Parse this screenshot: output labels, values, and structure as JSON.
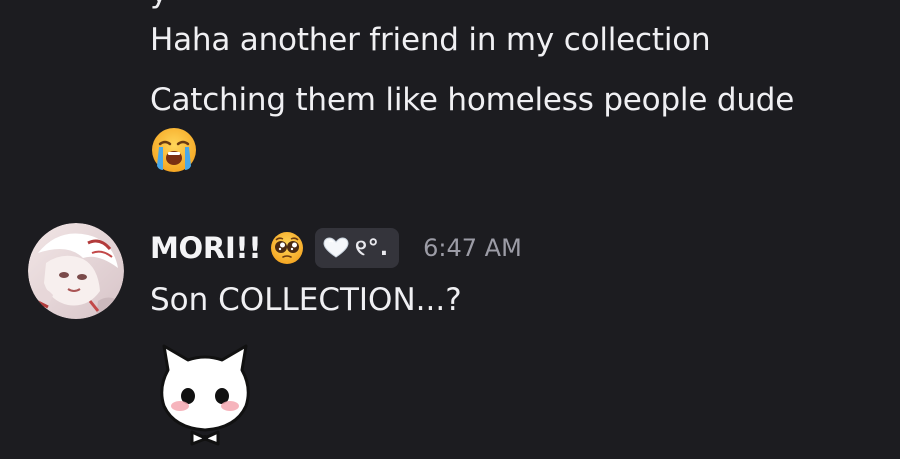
{
  "messages": [
    {
      "lines": [
        "Haha another friend in my collection",
        "Catching them like homeless people dude"
      ],
      "emoji": "loudly-crying-face-emoji"
    },
    {
      "author": "MORI!!",
      "author_emoji": "pleading-face-emoji",
      "tag": "୧°.",
      "tag_icon": "heart-icon",
      "timestamp": "6:47 AM",
      "text": "Son COLLECTION...?",
      "sticker": "white-cat-sticker"
    }
  ],
  "colors": {
    "background": "#1c1c20",
    "text": "#f0f0f3",
    "timestamp": "#9c9ca6",
    "tag_bg": "#34343b"
  }
}
